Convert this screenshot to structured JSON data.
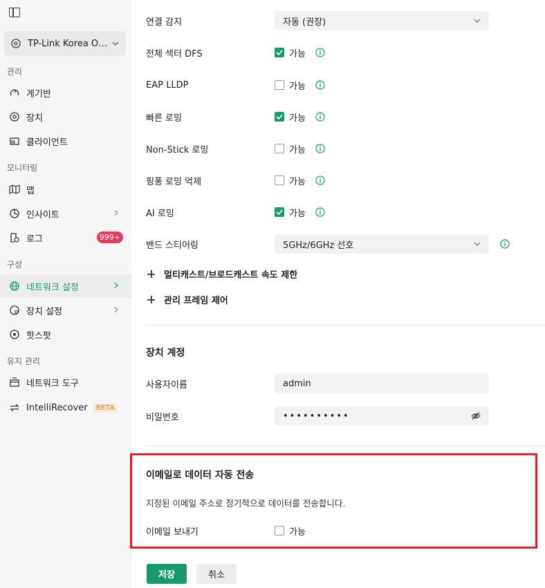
{
  "sidebar": {
    "site_name": "TP-Link Korea Offi...",
    "sections": {
      "manage": "관리",
      "monitoring": "모니터링",
      "config": "구성",
      "maintenance": "유지 관리"
    },
    "items": {
      "dashboard": "계기반",
      "devices": "장치",
      "clients": "클라이언트",
      "map": "맵",
      "insights": "인사이트",
      "logs": "로그",
      "logs_badge": "999+",
      "network_settings": "네트워크 설정",
      "device_settings": "장치 설정",
      "hotspot": "핫스팟",
      "network_tools": "네트워크 도구",
      "intellirecover": "IntelliRecover",
      "beta": "BETA"
    }
  },
  "settings": {
    "connection_detect": {
      "label": "연결 감지",
      "value": "자동 (권장)"
    },
    "all_sector_dfs": {
      "label": "전체 섹터 DFS",
      "option": "가능",
      "checked": true
    },
    "eap_lldp": {
      "label": "EAP LLDP",
      "option": "가능",
      "checked": false
    },
    "fast_roaming": {
      "label": "빠른 로밍",
      "option": "가능",
      "checked": true
    },
    "non_stick_roaming": {
      "label": "Non-Stick 로밍",
      "option": "가능",
      "checked": false
    },
    "pingpong_roaming": {
      "label": "핑퐁 로밍 억제",
      "option": "가능",
      "checked": false
    },
    "ai_roaming": {
      "label": "AI 로밍",
      "option": "가능",
      "checked": true
    },
    "band_steering": {
      "label": "밴드 스티어링",
      "value": "5GHz/6GHz 선호"
    },
    "multicast_limit": "멀티캐스트/브로드캐스트 속도 제한",
    "mgmt_frame": "관리 프레임 제어"
  },
  "device_account": {
    "title": "장치 계정",
    "username_label": "사용자이름",
    "username_value": "admin",
    "password_label": "비밀번호",
    "password_value": "••••••••••"
  },
  "email": {
    "title": "이메일로 데이터 자동 전송",
    "description": "지정된 이메일 주소로 정기적으로 데이터를 전송합니다.",
    "send_label": "이메일 보내기",
    "option": "가능",
    "checked": false
  },
  "actions": {
    "save": "저장",
    "cancel": "취소"
  },
  "colors": {
    "accent": "#1a9a6a",
    "highlight_border": "#d4222a",
    "badge": "#e23c5a"
  }
}
